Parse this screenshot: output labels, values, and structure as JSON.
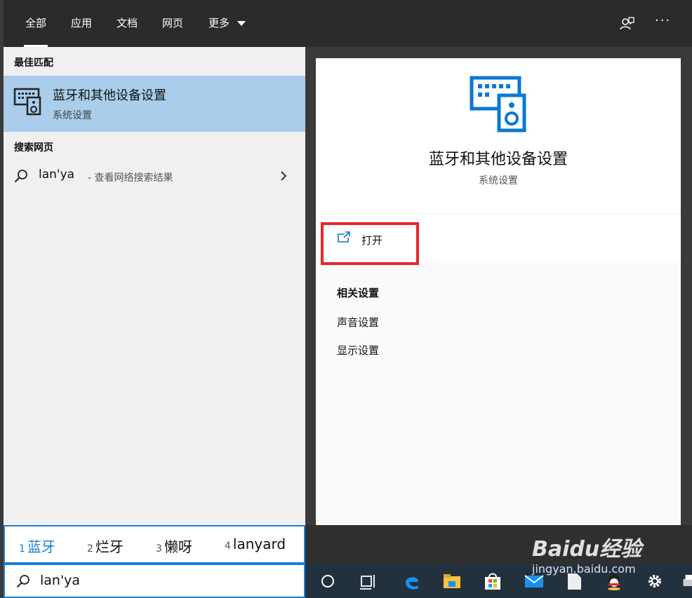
{
  "tabs": [
    {
      "label": "全部",
      "active": true
    },
    {
      "label": "应用",
      "active": false
    },
    {
      "label": "文档",
      "active": false
    },
    {
      "label": "网页",
      "active": false
    },
    {
      "label": "更多",
      "active": false,
      "icon": "chevron-down-icon"
    }
  ],
  "tabbar_icons": [
    "feedback-icon",
    "more-options-icon"
  ],
  "tabbar_more_glyph": "···",
  "left_pane": {
    "best_match_heading": "最佳匹配",
    "best_match": {
      "title": "蓝牙和其他设备设置",
      "subtitle": "系统设置",
      "icon": "devices-icon"
    },
    "web_heading": "搜索网页",
    "web_result": {
      "query": "lan'ya",
      "hint": "- 查看网络搜索结果",
      "icon": "search-icon"
    }
  },
  "right_pane": {
    "title": "蓝牙和其他设备设置",
    "subtitle": "系统设置",
    "open_label": "打开",
    "related_heading": "相关设置",
    "related_items": [
      "声音设置",
      "显示设置"
    ]
  },
  "ime": {
    "candidates": [
      {
        "num": "1",
        "text": "蓝牙"
      },
      {
        "num": "2",
        "text": "烂牙"
      },
      {
        "num": "3",
        "text": "懒呀"
      },
      {
        "num": "4",
        "text": "lanyard"
      }
    ]
  },
  "search": {
    "value": "lan'ya"
  },
  "taskbar": {
    "icons": [
      "cortana-icon",
      "task-view-icon",
      "edge-icon",
      "file-explorer-icon",
      "store-icon",
      "mail-icon",
      "file-icon",
      "qq-icon",
      "settings-icon",
      "printer-icon"
    ]
  },
  "watermark": {
    "text": "Baidu经验",
    "sub": "jingyan.baidu.com"
  },
  "colors": {
    "accent": "#1a7fd3",
    "highlight": "#e8252b",
    "selected": "#a9cdea"
  }
}
